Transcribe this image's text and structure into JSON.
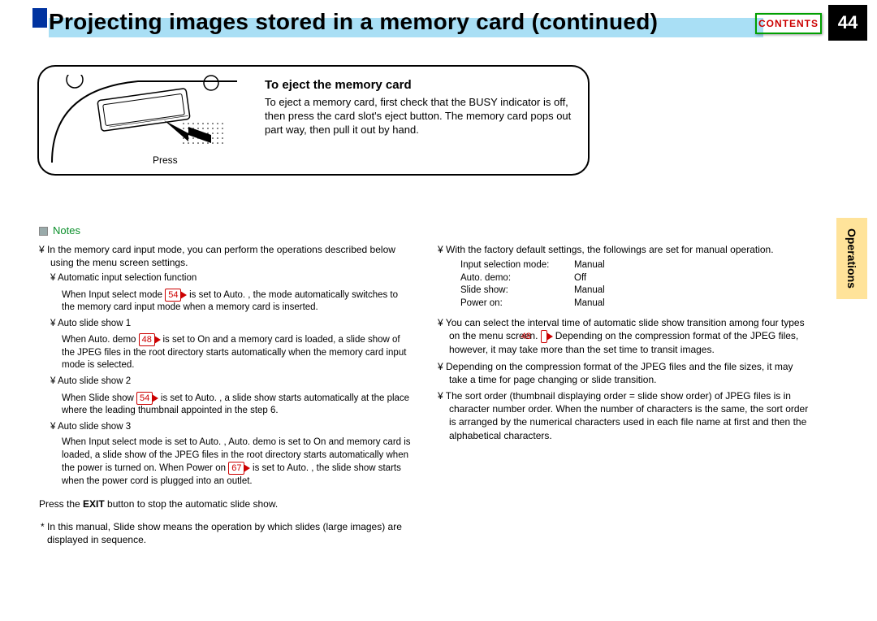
{
  "header": {
    "title": "Projecting images stored in a memory card (continued)",
    "page_number": "44",
    "contents_button": "CONTENTS"
  },
  "side_tab": "Operations",
  "callout": {
    "title": "To eject the memory card",
    "body": "To eject a memory card, first check that the BUSY indicator is off, then press the card slot's eject button. The memory card pops out part way, then pull it out by hand.",
    "press_label": "Press"
  },
  "notes_header": "Notes",
  "refs": {
    "p54a": "54",
    "p48a": "48",
    "p54b": "54",
    "p67": "67",
    "p48b": "48"
  },
  "left": {
    "l1": "¥  In the memory card input mode, you can perform the operations described below using the menu screen settings.",
    "a_t": "¥  Automatic input selection function",
    "a_b1": "When  Input select mode ",
    "a_b2": " is set to  Auto. , the mode automatically switches to the memory card input mode when a memory card is inserted.",
    "b_t": "¥  Auto slide show 1",
    "b_b1": "When  Auto. demo ",
    "b_b2": " is set to  On  and a memory card is loaded, a slide show of the JPEG files in the root directory starts automatically when the memory card input mode is selected.",
    "c_t": "¥  Auto slide show 2",
    "c_b1": "When  Slide show ",
    "c_b2": " is set to  Auto. , a slide show starts automatically at the place where the leading thumbnail appointed in the step 6.",
    "d_t": "¥  Auto slide show 3",
    "d_b1": "When  Input select mode  is set to  Auto. ,  Auto. demo  is set to  On  and memory card is loaded, a slide show of the JPEG files in the root directory starts automatically when the power is turned on. When  Power on ",
    "d_b2": " is set to  Auto. , the slide show starts when the power cord is plugged into an outlet.",
    "exit1": "Press the ",
    "exit_b": "EXIT",
    "exit2": " button to stop the automatic slide show.",
    "asterisk": "*  In this manual,  Slide show  means the operation by which slides (large images) are displayed in sequence."
  },
  "right": {
    "r1": "¥  With the factory default settings, the followings are set for manual operation.",
    "settings": [
      {
        "k": "Input selection mode:",
        "v": "Manual"
      },
      {
        "k": "Auto. demo:",
        "v": "Off"
      },
      {
        "k": "Slide show:",
        "v": "Manual"
      },
      {
        "k": "Power on:",
        "v": "Manual"
      }
    ],
    "r2a": "¥  You can select the interval time of automatic slide show transition among four types on the menu screen. ",
    "r2b": "  Depending on the compression format of the JPEG files, however, it may take more than the set time to transit images.",
    "r3": "¥  Depending on the compression format of the JPEG files and the file sizes, it may take a time for page changing or slide transition.",
    "r4": "¥  The sort order (thumbnail displaying order = slide show order) of JPEG files is in character number order. When the number of characters is the same, the sort order is arranged by the numerical characters used in each file name at first and then the alphabetical characters."
  }
}
